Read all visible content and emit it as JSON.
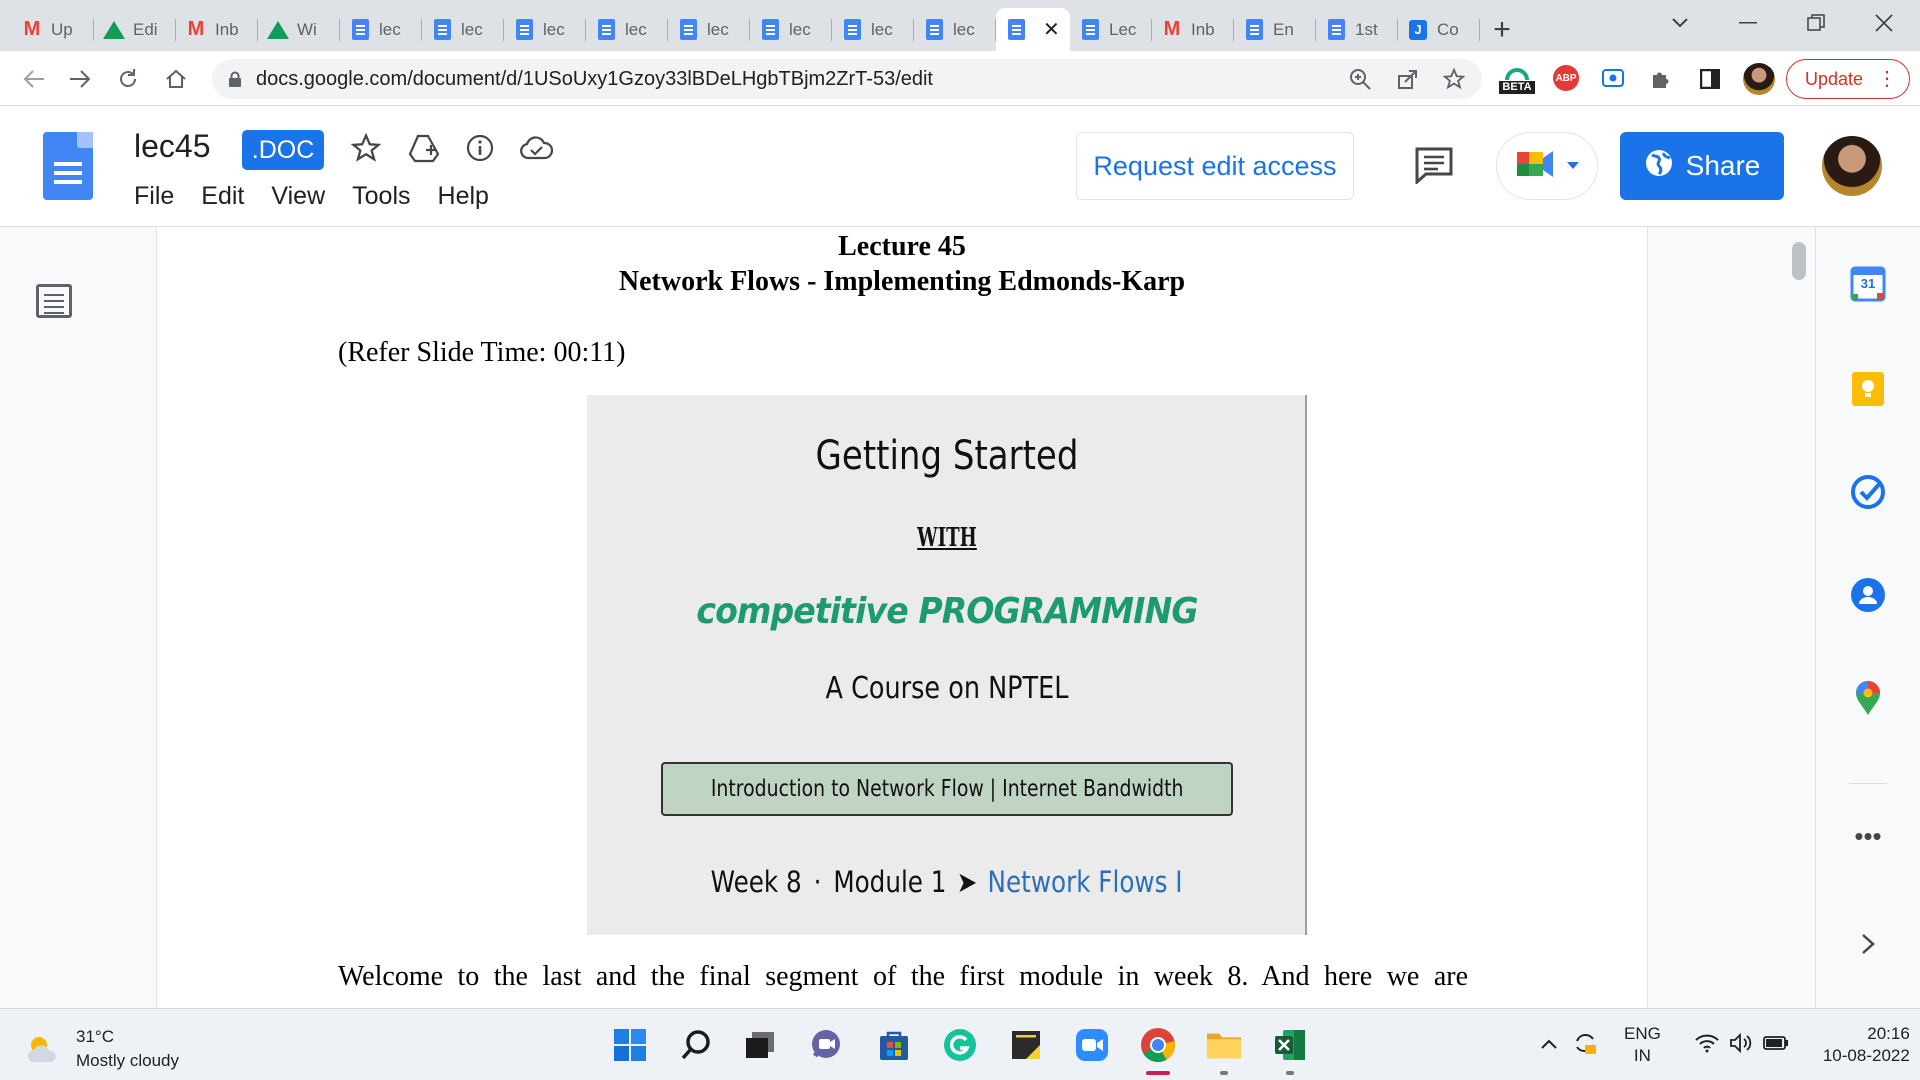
{
  "browser": {
    "tabs": [
      {
        "label": "Up",
        "icon": "gmail-icon"
      },
      {
        "label": "Edi",
        "icon": "drive-icon"
      },
      {
        "label": "Inb",
        "icon": "gmail-icon"
      },
      {
        "label": "Wi",
        "icon": "drive-icon"
      },
      {
        "label": "lec",
        "icon": "docs-icon"
      },
      {
        "label": "lec",
        "icon": "docs-icon"
      },
      {
        "label": "lec",
        "icon": "docs-icon"
      },
      {
        "label": "lec",
        "icon": "docs-icon"
      },
      {
        "label": "lec",
        "icon": "docs-icon"
      },
      {
        "label": "lec",
        "icon": "docs-icon"
      },
      {
        "label": "lec",
        "icon": "docs-icon"
      },
      {
        "label": "lec",
        "icon": "docs-icon"
      },
      {
        "label": "",
        "icon": "docs-icon",
        "active": true
      },
      {
        "label": "Lec",
        "icon": "docs-icon"
      },
      {
        "label": "Inb",
        "icon": "gmail-icon"
      },
      {
        "label": "En",
        "icon": "docs-icon"
      },
      {
        "label": "1st",
        "icon": "docs-icon"
      },
      {
        "label": "Co",
        "icon": "jamboard-icon"
      }
    ],
    "url": "docs.google.com/document/d/1USoUxy1Gzoy33lBDeLHgbTBjm2ZrT-53/edit",
    "beta_label": "BETA",
    "abp_label": "ABP",
    "update_label": "Update"
  },
  "docs": {
    "title": "lec45",
    "badge": ".DOC",
    "menu": [
      "File",
      "Edit",
      "View",
      "Tools",
      "Help"
    ],
    "request_edit_label": "Request edit access",
    "share_label": "Share"
  },
  "document": {
    "lecture_title": "Lecture 45",
    "lecture_subtitle": "Network Flows - Implementing Edmonds-Karp",
    "refer_slide": "(Refer Slide Time: 00:11)",
    "slide": {
      "line1": "Getting Started",
      "line2": "WITH",
      "line3": "competitive PROGRAMMING",
      "line4": "A Course on NPTEL",
      "box_text": "Introduction to Network Flow | Internet Bandwidth",
      "week": "Week 8",
      "dot": "·",
      "module": "Module 1",
      "arrow": "➤",
      "topic": "Network Flows I",
      "topic_color": "#2a6fb7",
      "box_color": "#c0d4c3",
      "accent_color": "#1e9a70"
    },
    "paragraph": "Welcome to the last and the final segment of the first module in week 8. And here we are"
  },
  "side_panel": {
    "calendar_day": "31"
  },
  "taskbar": {
    "temperature": "31°C",
    "weather": "Mostly cloudy",
    "lang_top": "ENG",
    "lang_bottom": "IN",
    "time": "20:16",
    "date": "10-08-2022"
  }
}
